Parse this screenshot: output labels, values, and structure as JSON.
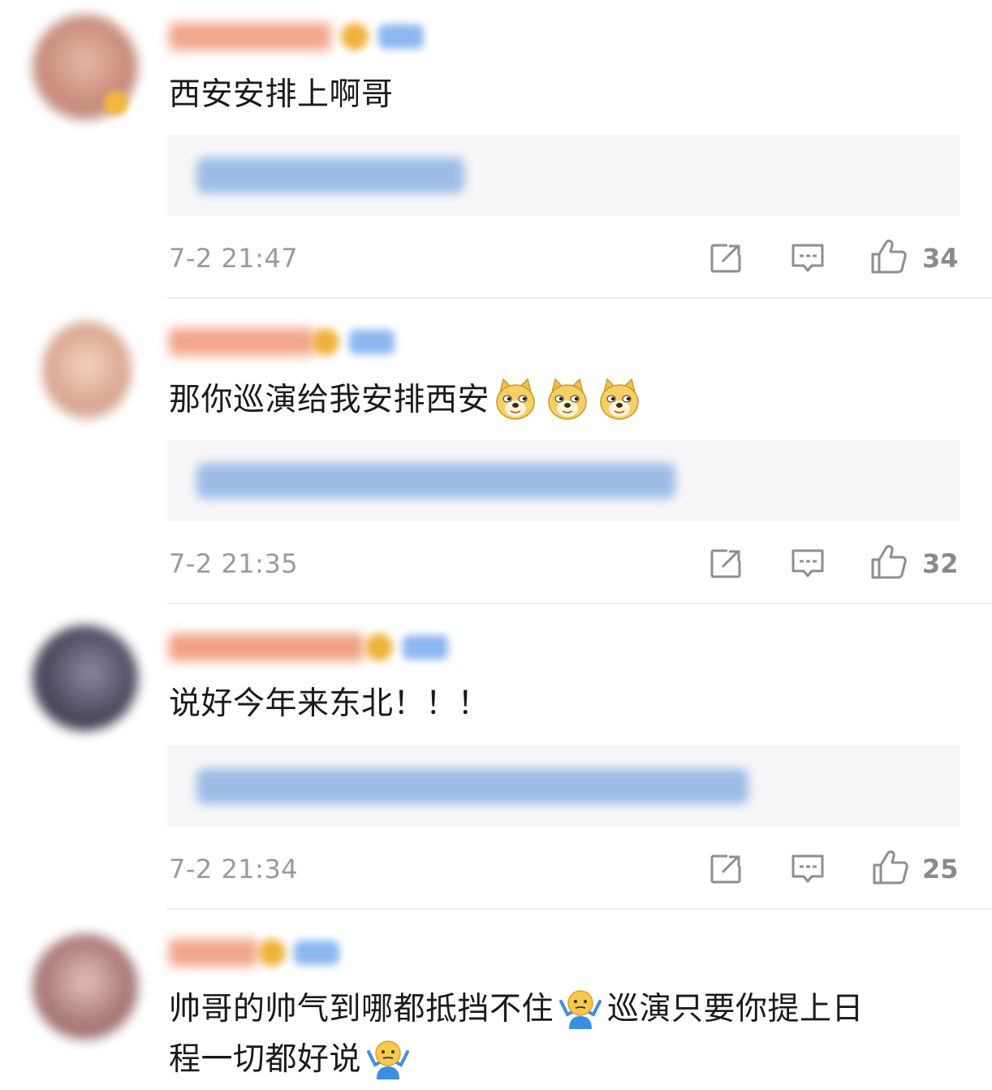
{
  "comments": [
    {
      "text": "西安安排上啊哥",
      "emojis": [],
      "time": "7-2 21:47",
      "likes": "34",
      "avatar_color": "#d9a89a"
    },
    {
      "text": "那你巡演给我安排西安",
      "emojis": [
        "doge-emoji",
        "doge-emoji",
        "doge-emoji"
      ],
      "time": "7-2 21:35",
      "likes": "32",
      "avatar_color": "#e8c2b2"
    },
    {
      "text": "说好今年来东北！！！",
      "emojis": [],
      "time": "7-2 21:34",
      "likes": "25",
      "avatar_color": "#5b5a6e"
    },
    {
      "text_line1": "帅哥的帅气到哪都抵挡不住",
      "text_line1b": "巡演只要你提上日",
      "text_line2": "程一切都好说",
      "emojis": [
        "shrug-emoji",
        "shrug-emoji"
      ],
      "avatar_color": "#c79a92"
    }
  ],
  "colors": {
    "time": "#9a9a9a",
    "reply_link": "#4d8ed6",
    "reply_bg": "#f6f6f8",
    "icon": "#8e8e8e"
  }
}
